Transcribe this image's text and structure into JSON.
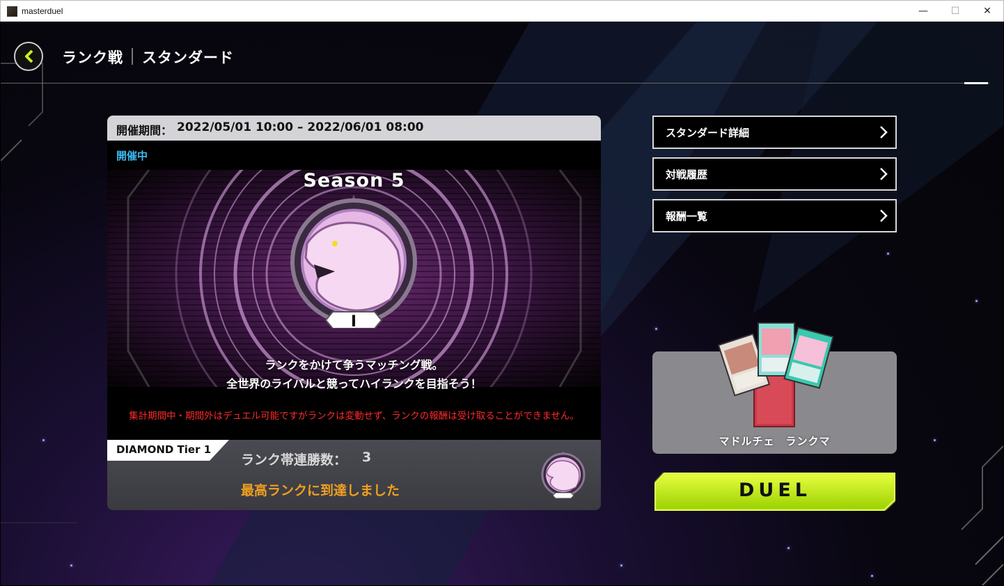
{
  "window": {
    "title": "masterduel",
    "minimize": "—",
    "maximize": "☐",
    "close": "✕"
  },
  "header": {
    "title": "ランク戦",
    "subtitle": "スタンダード"
  },
  "period": {
    "label": "開催期間：",
    "value": "2022/05/01 10:00 – 2022/06/01 08:00",
    "status": "開催中"
  },
  "season": {
    "title": "Season 5",
    "emblem_numeral": "I",
    "description_line1": "ランクをかけて争うマッチング戦。",
    "description_line2": "全世界のライバルと競ってハイランクを目指そう！",
    "warning": "集計期間中・期間外はデュエル可能ですがランクは変動せず、ランクの報酬は受け取ることができません。"
  },
  "rank": {
    "tier": "DIAMOND Tier 1",
    "streak_label": "ランク帯連勝数：",
    "streak_value": "3",
    "top_rank_message": "最高ランクに到達しました"
  },
  "menu": [
    {
      "label": "スタンダード詳細",
      "icon": "chevron-right-icon"
    },
    {
      "label": "対戦履歴",
      "icon": "chevron-right-icon"
    },
    {
      "label": "報酬一覧",
      "icon": "chevron-right-icon"
    }
  ],
  "deck": {
    "name": "マドルチェ　ランクマ"
  },
  "duel": {
    "label": "DUEL"
  },
  "colors": {
    "status_blue": "#3fb8f0",
    "warning_red": "#ff2a2a",
    "top_rank_orange": "#f0a020",
    "duel_green": "#c8f020",
    "back_accent": "#c8f020"
  }
}
